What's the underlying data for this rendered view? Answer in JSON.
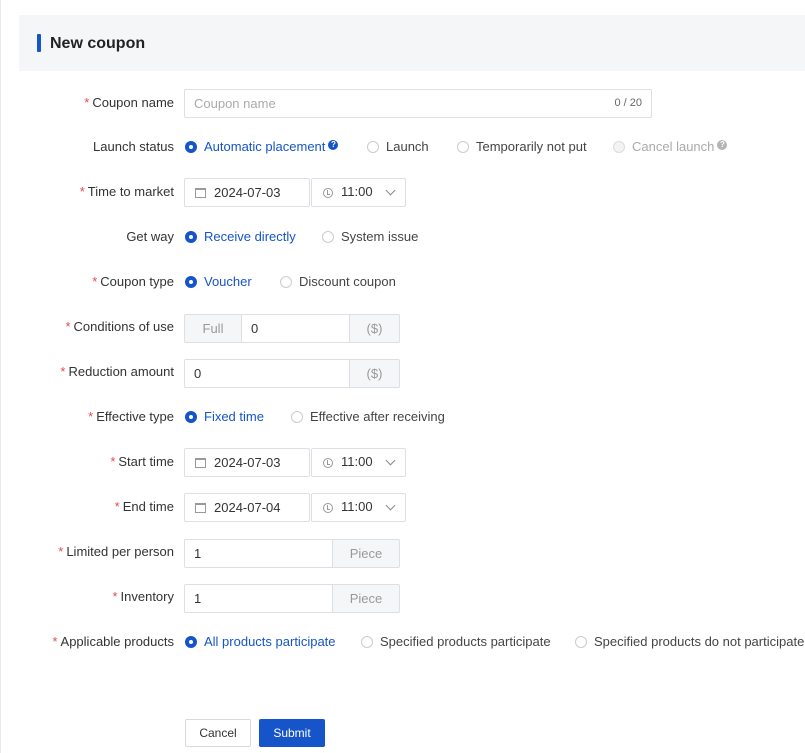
{
  "header": {
    "title": "New coupon"
  },
  "form": {
    "coupon_name": {
      "label": "Coupon name",
      "placeholder": "Coupon name",
      "counter": "0 / 20"
    },
    "launch_status": {
      "label": "Launch status",
      "options": [
        "Automatic placement",
        "Launch",
        "Temporarily not put",
        "Cancel launch"
      ],
      "selected": "Automatic placement",
      "disabled": "Cancel launch"
    },
    "time_to_market": {
      "label": "Time to market",
      "date": "2024-07-03",
      "time": "11:00"
    },
    "get_way": {
      "label": "Get way",
      "options": [
        "Receive directly",
        "System issue"
      ],
      "selected": "Receive directly"
    },
    "coupon_type": {
      "label": "Coupon type",
      "options": [
        "Voucher",
        "Discount coupon"
      ],
      "selected": "Voucher"
    },
    "conditions_of_use": {
      "label": "Conditions of use",
      "prefix": "Full",
      "value": "0",
      "suffix": "($)"
    },
    "reduction_amount": {
      "label": "Reduction amount",
      "value": "0",
      "suffix": "($)"
    },
    "effective_type": {
      "label": "Effective type",
      "options": [
        "Fixed time",
        "Effective after receiving"
      ],
      "selected": "Fixed time"
    },
    "start_time": {
      "label": "Start time",
      "date": "2024-07-03",
      "time": "11:00"
    },
    "end_time": {
      "label": "End time",
      "date": "2024-07-04",
      "time": "11:00"
    },
    "limited_per_person": {
      "label": "Limited per person",
      "value": "1",
      "suffix": "Piece"
    },
    "inventory": {
      "label": "Inventory",
      "value": "1",
      "suffix": "Piece"
    },
    "applicable_products": {
      "label": "Applicable products",
      "options": [
        "All products participate",
        "Specified products participate",
        "Specified products do not participate"
      ],
      "selected": "All products participate"
    }
  },
  "actions": {
    "cancel_label": "Cancel",
    "submit_label": "Submit"
  },
  "required_mark": "*",
  "help_glyph": "?",
  "colors": {
    "accent": "#1654c9",
    "required": "#e84a4a",
    "header_bg": "#f5f6f7"
  }
}
